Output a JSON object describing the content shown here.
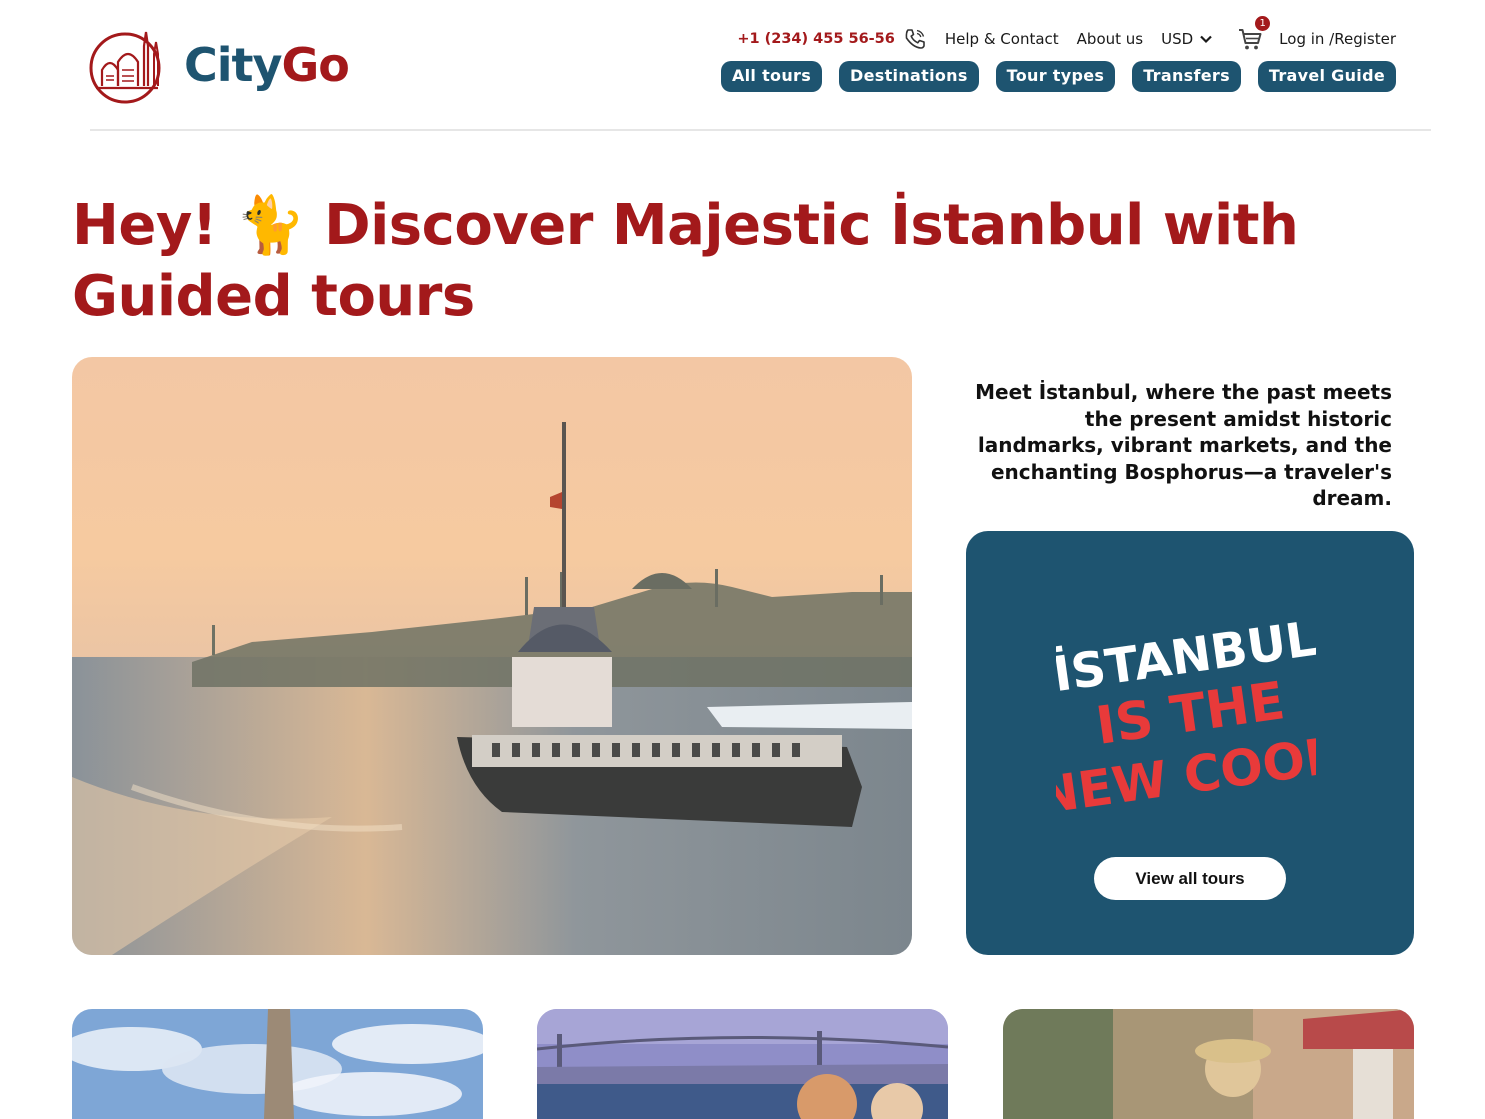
{
  "brand": {
    "name_part1": "City",
    "name_part2": "Go"
  },
  "topbar": {
    "phone": "+1 (234) 455 56-56",
    "help": "Help & Contact",
    "about": "About us",
    "currency": "USD",
    "cart_count": "1",
    "login": "Log in /Register"
  },
  "nav": [
    "All tours",
    "Destinations",
    "Tour types",
    "Transfers",
    "Travel Guide"
  ],
  "hero": {
    "title_line1": "Hey! 🐈 Discover Majestic İstanbul with",
    "title_line2": "Guided tours",
    "intro": "Meet İstanbul, where the past meets the present amidst historic landmarks, vibrant markets, and the enchanting Bosphorus—a traveler's dream."
  },
  "promo": {
    "line1": "İSTANBUL",
    "line2": "IS THE",
    "line3": "NEW COOL",
    "button": "View all tours"
  },
  "colors": {
    "brand_red": "#a3191b",
    "brand_blue": "#1e5470",
    "promo_red": "#e83a3a"
  },
  "icons": [
    "phone-icon",
    "chevron-down-icon",
    "cart-icon",
    "logo-mark-icon"
  ]
}
